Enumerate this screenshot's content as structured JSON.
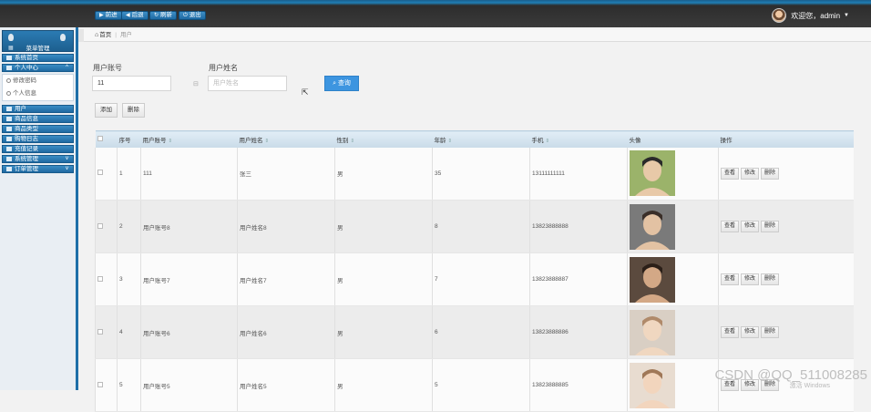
{
  "topbar": {
    "buttons": [
      {
        "icon": "▶",
        "label": "前进"
      },
      {
        "icon": "◀",
        "label": "后退"
      },
      {
        "icon": "↻",
        "label": "刷新"
      },
      {
        "icon": "⏻",
        "label": "退出"
      }
    ],
    "user_greeting": "欢迎您，admin"
  },
  "sidebar": {
    "header": "菜单管理",
    "items": [
      {
        "label": "系统首页"
      },
      {
        "label": "个人中心",
        "expanded": true,
        "children": [
          "修改密码",
          "个人信息"
        ]
      },
      {
        "label": "用户"
      },
      {
        "label": "商品信息"
      },
      {
        "label": "商品类型"
      },
      {
        "label": "购物日志"
      },
      {
        "label": "充值记录"
      },
      {
        "label": "系统管理",
        "collapsible": true
      },
      {
        "label": "订单管理",
        "collapsible": true
      }
    ]
  },
  "breadcrumb": {
    "home": "首页",
    "current": "用户"
  },
  "filters": {
    "account_label": "用户账号",
    "account_value": "11",
    "name_label": "用户姓名",
    "name_placeholder": "用户姓名",
    "search_label": "查询"
  },
  "actions": {
    "add": "添加",
    "delete": "删除"
  },
  "table": {
    "headers": [
      "序号",
      "用户账号",
      "用户姓名",
      "性别",
      "年龄",
      "手机",
      "头像",
      "操作"
    ],
    "row_actions": [
      "查看",
      "修改",
      "删除"
    ],
    "rows": [
      {
        "index": "1",
        "account": "111",
        "name": "张三",
        "gender": "男",
        "age": "35",
        "phone": "13111111111"
      },
      {
        "index": "2",
        "account": "用户账号8",
        "name": "用户姓名8",
        "gender": "男",
        "age": "8",
        "phone": "13823888888"
      },
      {
        "index": "3",
        "account": "用户账号7",
        "name": "用户姓名7",
        "gender": "男",
        "age": "7",
        "phone": "13823888887"
      },
      {
        "index": "4",
        "account": "用户账号6",
        "name": "用户姓名6",
        "gender": "男",
        "age": "6",
        "phone": "13823888886"
      },
      {
        "index": "5",
        "account": "用户账号5",
        "name": "用户姓名5",
        "gender": "男",
        "age": "5",
        "phone": "13823888885"
      }
    ]
  },
  "watermark": "CSDN @QQ_511008285",
  "windows_hint": "激活 Windows",
  "colors": {
    "accent": "#3d95e0",
    "nav": "#1e6fa8",
    "topbar": "#333333"
  }
}
